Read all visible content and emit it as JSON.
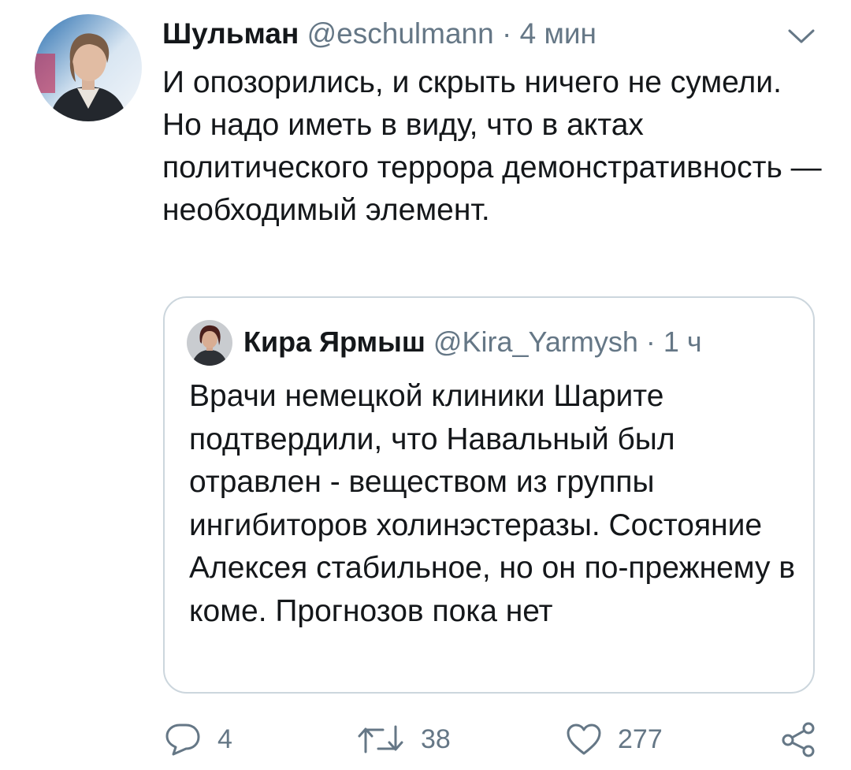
{
  "tweet": {
    "author_name": "Шульман",
    "author_handle": "@eschulmann",
    "separator": "·",
    "time": "4 мин",
    "text": "И опозорились, и скрыть ничего не сумели. Но надо иметь в виду, что в актах политического террора демонстративность — необходимый элемент."
  },
  "quoted_tweet": {
    "author_name": "Кира Ярмыш",
    "author_handle": "@Kira_Yarmysh",
    "separator": "·",
    "time": "1 ч",
    "text": "Врачи немецкой клиники Шарите подтвердили, что Навальный был отравлен - веществом из группы ингибиторов холинэстеразы. Состояние Алексея стабильное, но он по-прежнему в коме. Прогнозов пока нет"
  },
  "actions": {
    "replies": "4",
    "retweets": "38",
    "likes": "277"
  },
  "icons": {
    "menu": "chevron-down-icon",
    "reply": "reply-icon",
    "retweet": "retweet-icon",
    "like": "heart-icon",
    "share": "share-icon"
  },
  "colors": {
    "text": "#14171a",
    "secondary": "#657786",
    "border": "#ccd6dd"
  }
}
